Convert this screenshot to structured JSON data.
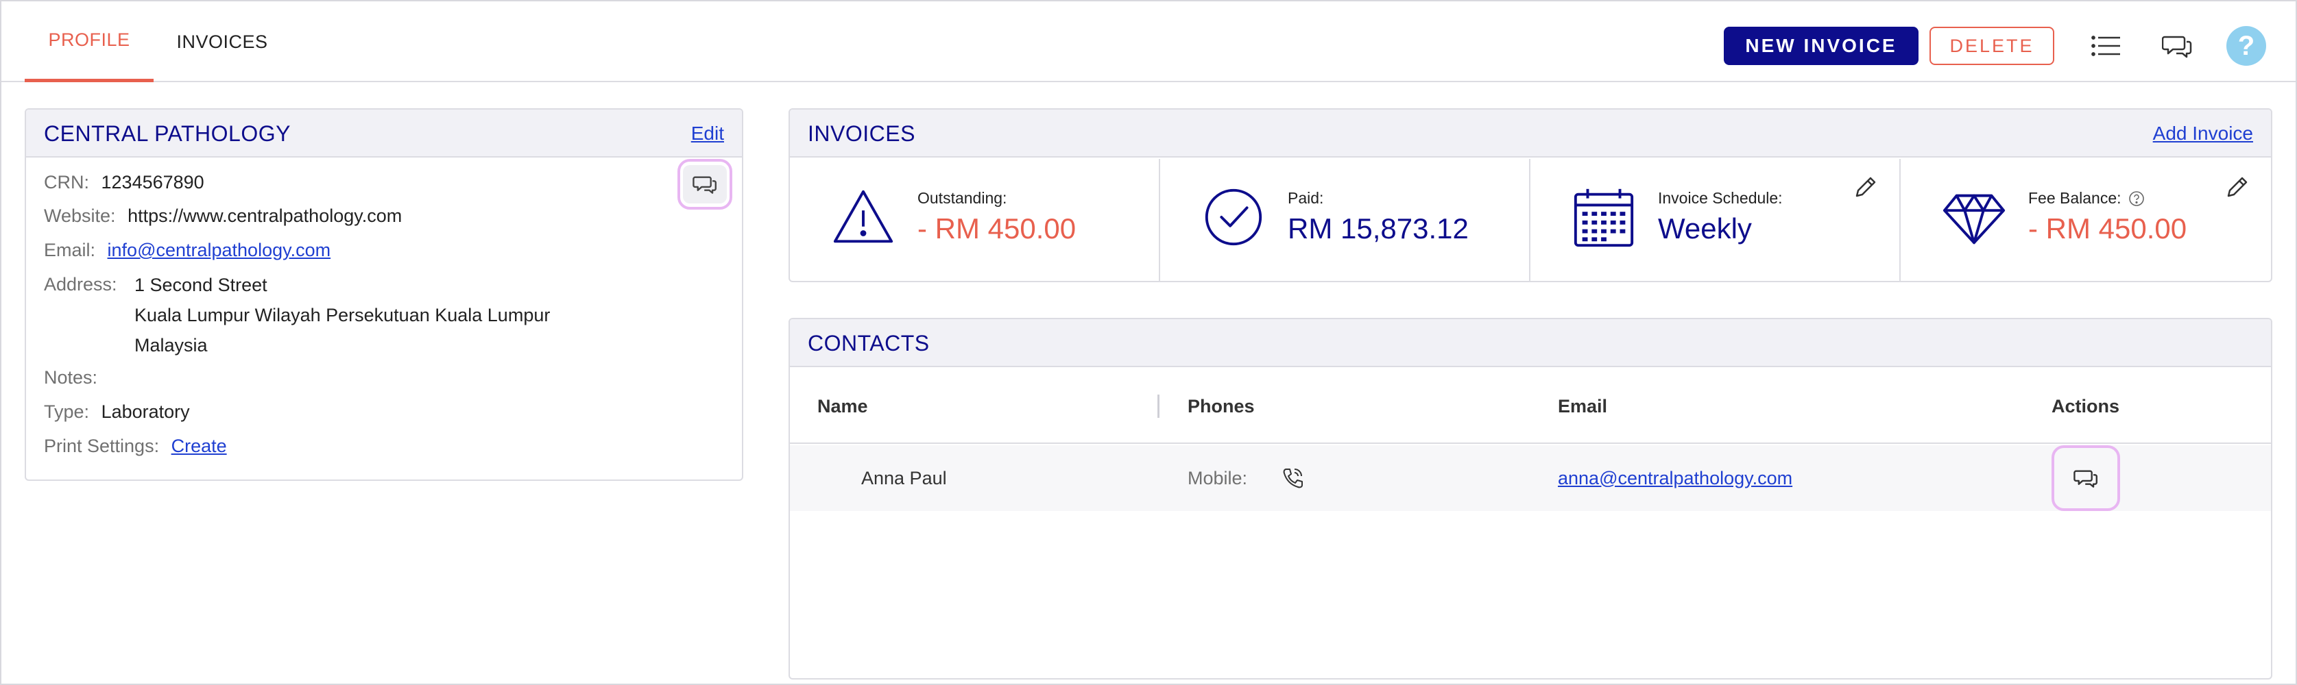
{
  "tabs": [
    {
      "label": "PROFILE",
      "active": true
    },
    {
      "label": "INVOICES",
      "active": false
    }
  ],
  "toolbar": {
    "new_invoice_label": "NEW INVOICE",
    "delete_label": "DELETE",
    "list_icon": "list-icon",
    "chat_icon": "chat-icon",
    "help_label": "?"
  },
  "profile": {
    "title": "CENTRAL PATHOLOGY",
    "edit_label": "Edit",
    "crn_label": "CRN:",
    "crn_value": "1234567890",
    "website_label": "Website:",
    "website_value": "https://www.centralpathology.com",
    "email_label": "Email:",
    "email_value": "info@centralpathology.com",
    "address_label": "Address:",
    "address_lines": [
      "1 Second Street",
      "Kuala Lumpur Wilayah Persekutuan Kuala Lumpur",
      "Malaysia"
    ],
    "notes_label": "Notes:",
    "type_label": "Type:",
    "type_value": "Laboratory",
    "print_label": "Print Settings:",
    "print_link": "Create"
  },
  "invoices": {
    "title": "INVOICES",
    "add_label": "Add Invoice",
    "stats": [
      {
        "label": "Outstanding:",
        "value": "- RM 450.00",
        "icon": "warning-icon"
      },
      {
        "label": "Paid:",
        "value": "RM 15,873.12",
        "icon": "check-circle-icon"
      },
      {
        "label": "Invoice Schedule:",
        "value": "Weekly",
        "icon": "calendar-icon"
      },
      {
        "label": "Fee Balance:",
        "value": "- RM 450.00",
        "icon": "diamond-icon"
      }
    ]
  },
  "contacts": {
    "title": "CONTACTS",
    "headers": [
      "Name",
      "Phones",
      "Email",
      "Actions"
    ],
    "rows": [
      {
        "name": "Anna Paul",
        "phone_label": "Mobile:",
        "email": "anna@centralpathology.com"
      }
    ]
  },
  "colors": {
    "brand_navy": "#0d0d8c",
    "accent_red": "#e8604e",
    "link_blue": "#1f3fd1",
    "highlight_pink": "#e8b6f2",
    "help_blue": "#8fd0ef"
  }
}
